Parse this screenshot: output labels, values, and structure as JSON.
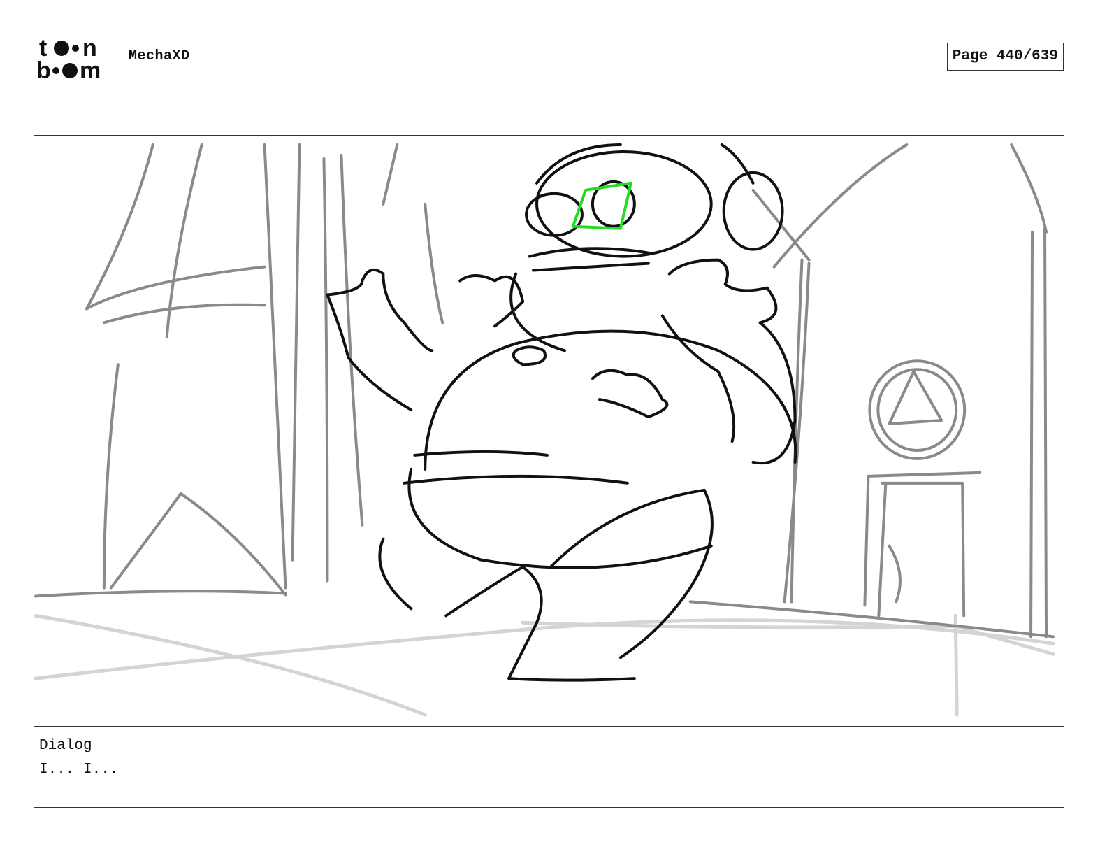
{
  "header": {
    "logo_text_top": "toon",
    "logo_text_bottom": "boom",
    "project_title": "MechaXD",
    "page_label": "Page 440/639"
  },
  "panel": {
    "image_alt": "storyboard sketch panel"
  },
  "dialog": {
    "heading": "Dialog",
    "text": "I... I..."
  },
  "colors": {
    "border": "#333333",
    "sketch_black": "#111111",
    "sketch_grey": "#808080",
    "sketch_lightgrey": "#d0d0d0",
    "highlight_green": "#22dd22"
  }
}
